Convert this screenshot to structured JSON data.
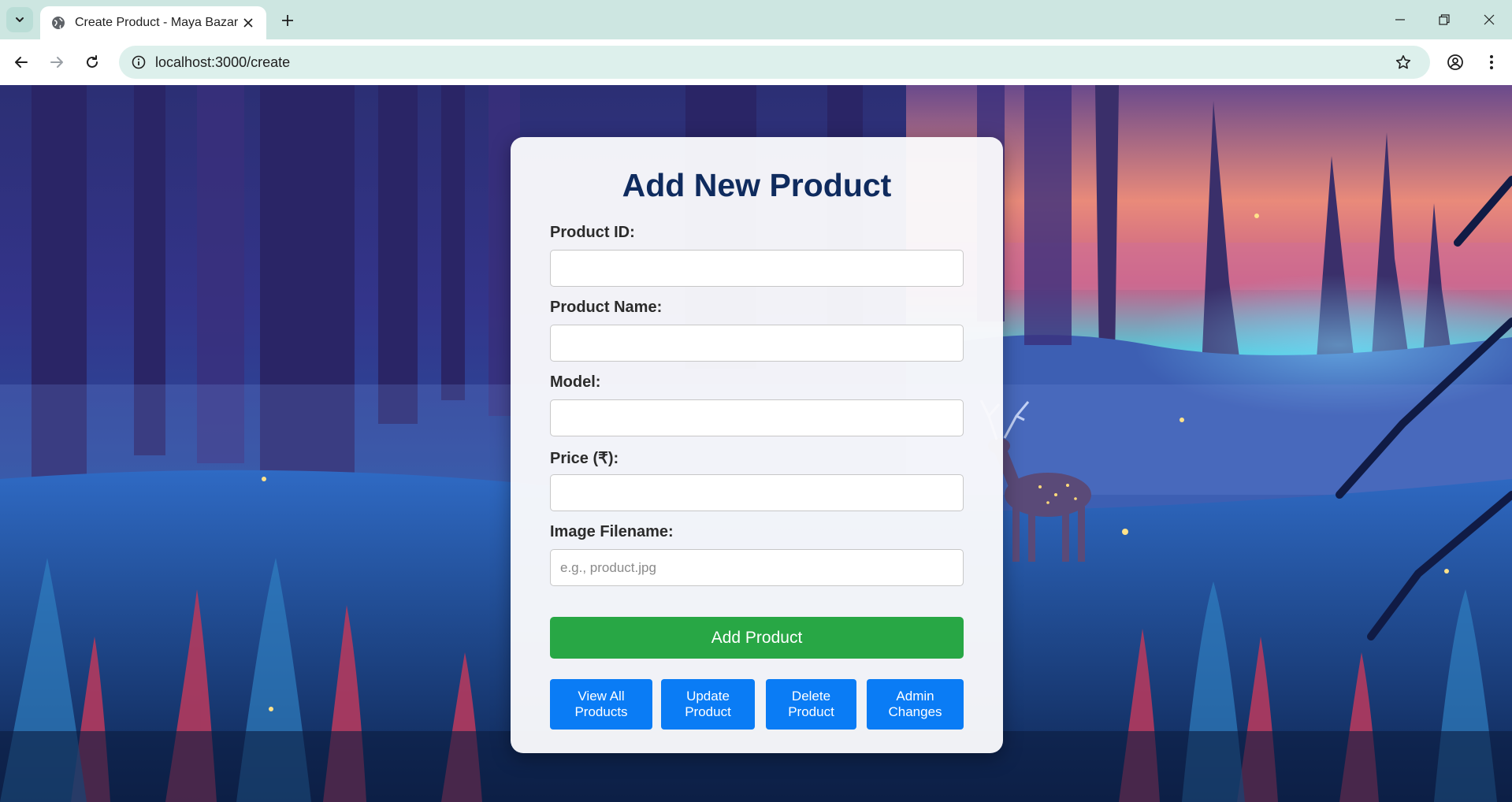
{
  "browser": {
    "tab_title": "Create Product - Maya Bazar",
    "url": "localhost:3000/create"
  },
  "form": {
    "title": "Add New Product",
    "fields": [
      {
        "label": "Product ID:",
        "value": "",
        "placeholder": ""
      },
      {
        "label": "Product Name:",
        "value": "",
        "placeholder": ""
      },
      {
        "label": "Model:",
        "value": "",
        "placeholder": ""
      },
      {
        "label": "Price (₹):",
        "value": "",
        "placeholder": ""
      },
      {
        "label": "Image Filename:",
        "value": "",
        "placeholder": "e.g., product.jpg"
      }
    ],
    "submit_label": "Add Product",
    "nav_buttons": [
      {
        "label": "View All\nProducts"
      },
      {
        "label": "Update\nProduct"
      },
      {
        "label": "Delete\nProduct"
      },
      {
        "label": "Admin\nChanges"
      }
    ]
  },
  "colors": {
    "submit": "#28a745",
    "nav_button": "#0a7cf5",
    "title": "#0f2b5e"
  }
}
